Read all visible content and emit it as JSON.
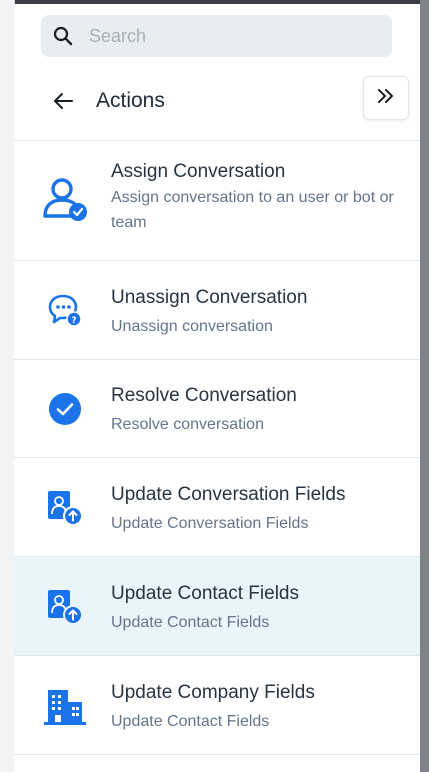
{
  "search": {
    "placeholder": "Search",
    "icon": "search-icon"
  },
  "header": {
    "title": "Actions",
    "back_icon": "arrow-left-icon",
    "collapse_icon": "chevrons-right-icon"
  },
  "colors": {
    "accent": "#1a73e8",
    "selected_bg": "#e9f4fb",
    "desc_text": "#65758a"
  },
  "actions": [
    {
      "label": "Assign Conversation",
      "description": "Assign conversation to an user or bot or team",
      "icon": "assign-user-icon"
    },
    {
      "label": "Unassign Conversation",
      "description": "Unassign conversation",
      "icon": "chat-question-icon"
    },
    {
      "label": "Resolve Conversation",
      "description": "Resolve conversation",
      "icon": "check-circle-icon"
    },
    {
      "label": "Update Conversation Fields",
      "description": "Update Conversation Fields",
      "icon": "contact-card-upload-icon"
    },
    {
      "label": "Update Contact Fields",
      "description": "Update Contact Fields",
      "icon": "contact-card-upload-icon",
      "selected": true
    },
    {
      "label": "Update Company Fields",
      "description": "Update Contact Fields",
      "icon": "building-icon"
    }
  ]
}
